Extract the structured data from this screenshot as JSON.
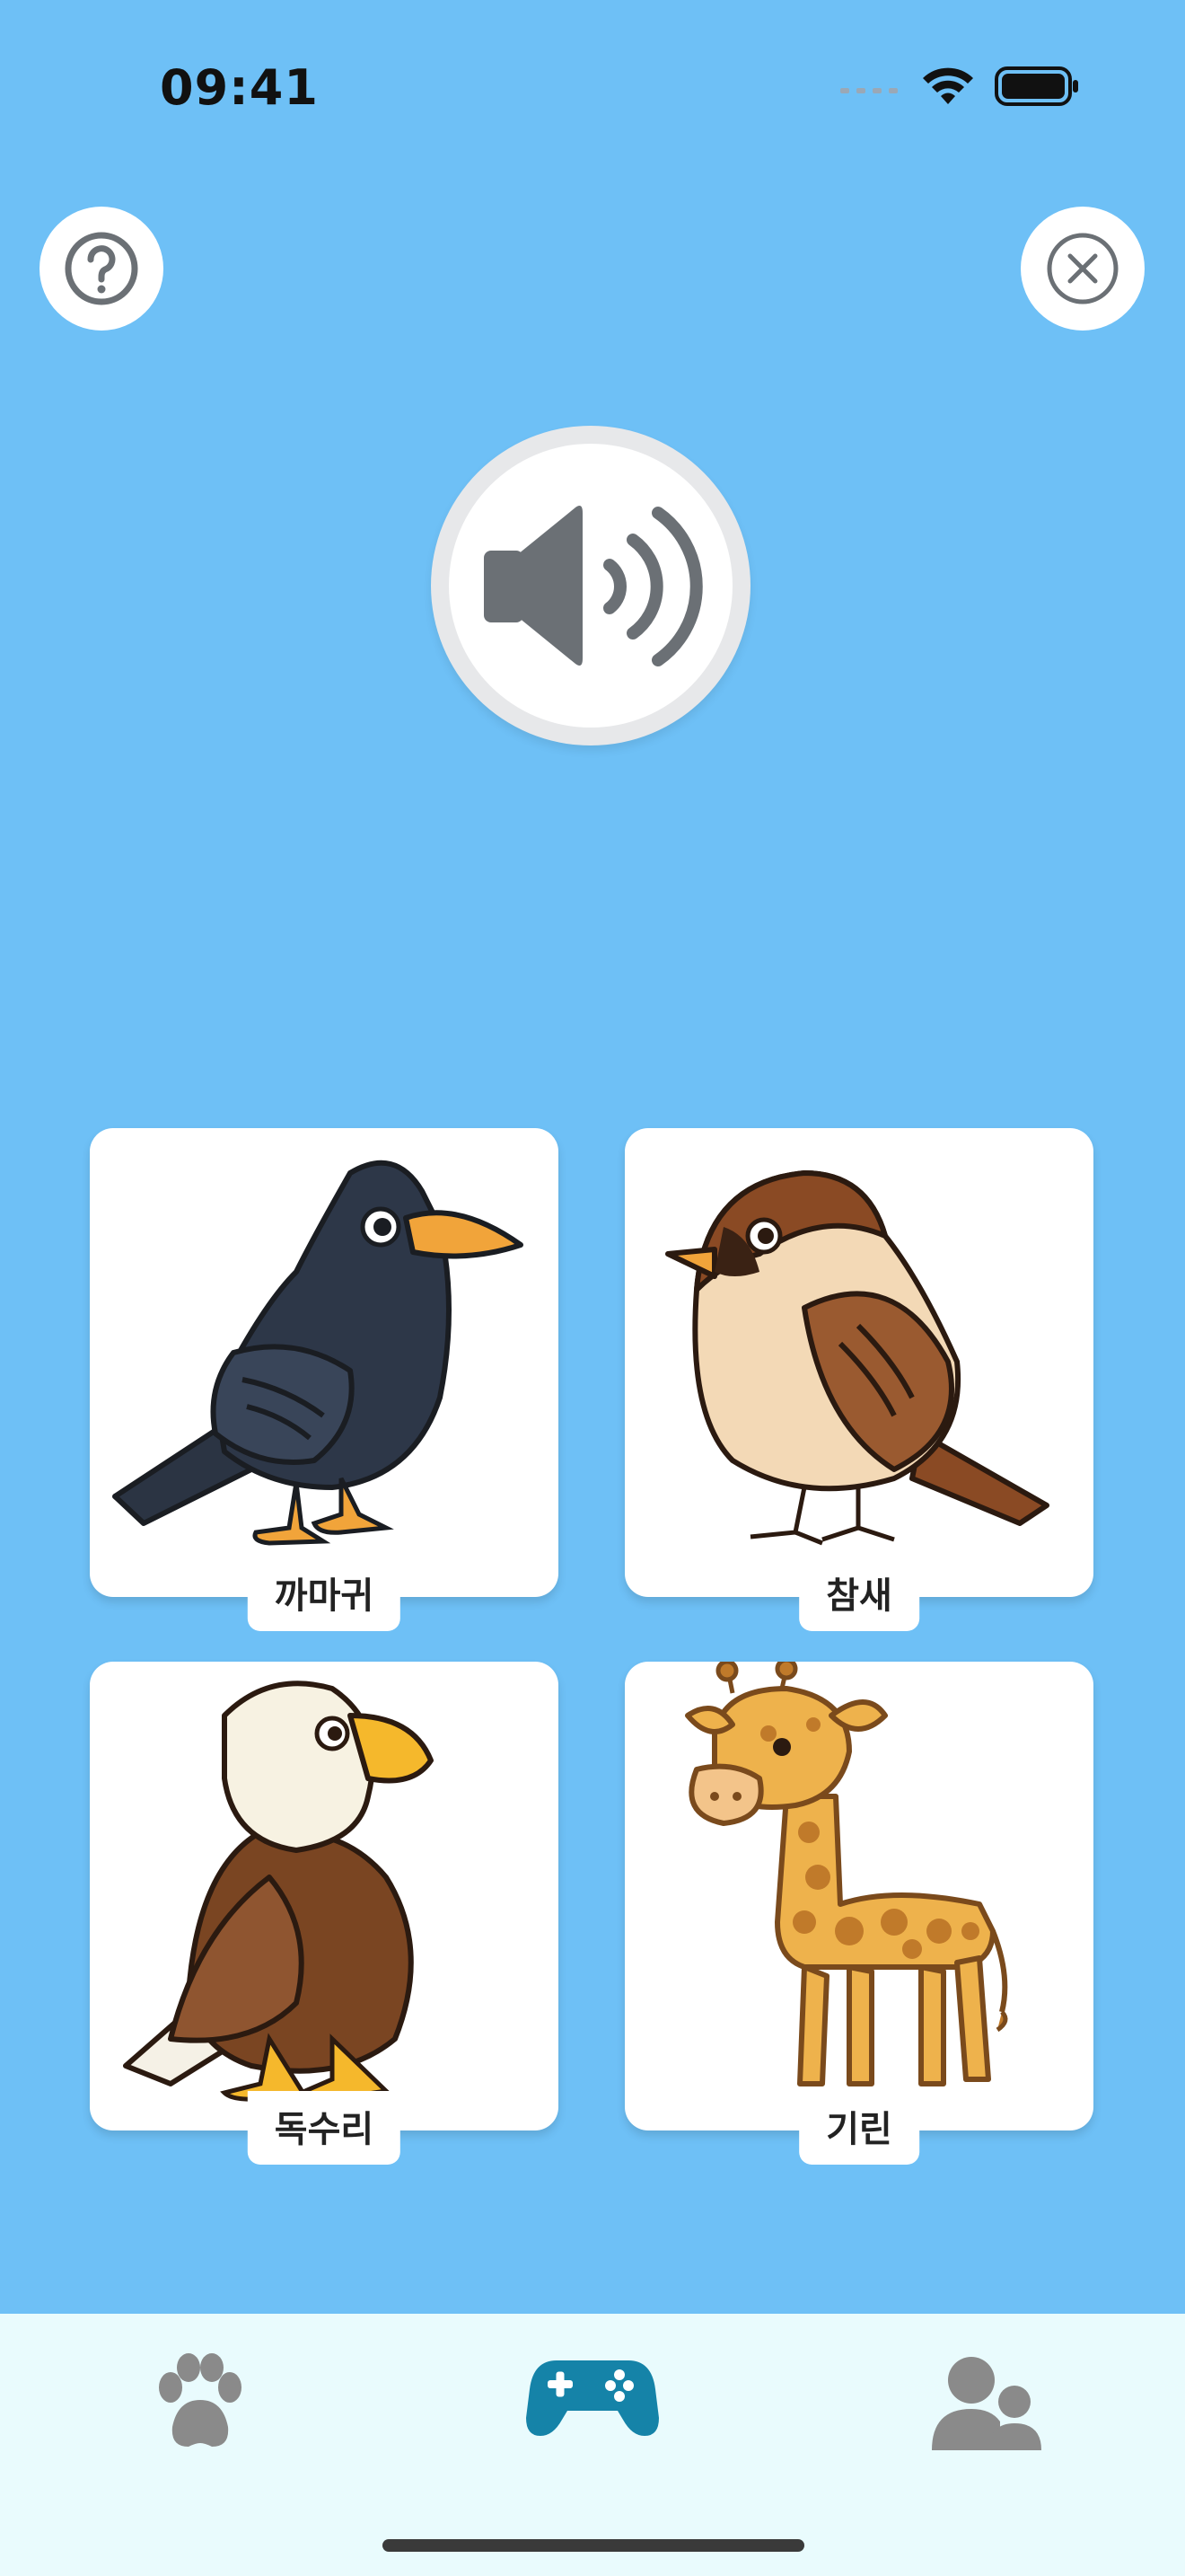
{
  "status_bar": {
    "time": "09:41"
  },
  "header": {
    "help_icon": "question-circle-icon",
    "close_icon": "close-circle-icon"
  },
  "sound_button": {
    "icon": "speaker-wave-icon"
  },
  "choices": [
    {
      "label": "까마귀",
      "image": "crow"
    },
    {
      "label": "참새",
      "image": "sparrow"
    },
    {
      "label": "독수리",
      "image": "eagle"
    },
    {
      "label": "기린",
      "image": "giraffe"
    }
  ],
  "tab_bar": {
    "tabs": [
      {
        "icon": "paw-icon",
        "active": false,
        "color": "#8a8a8a"
      },
      {
        "icon": "gamepad-icon",
        "active": true,
        "color": "#1583a8"
      },
      {
        "icon": "users-icon",
        "active": false,
        "color": "#8a8a8a"
      }
    ]
  },
  "colors": {
    "background": "#6ec0f6",
    "accent": "#1583a8",
    "tab_bar_bg": "#e9fbfd"
  }
}
